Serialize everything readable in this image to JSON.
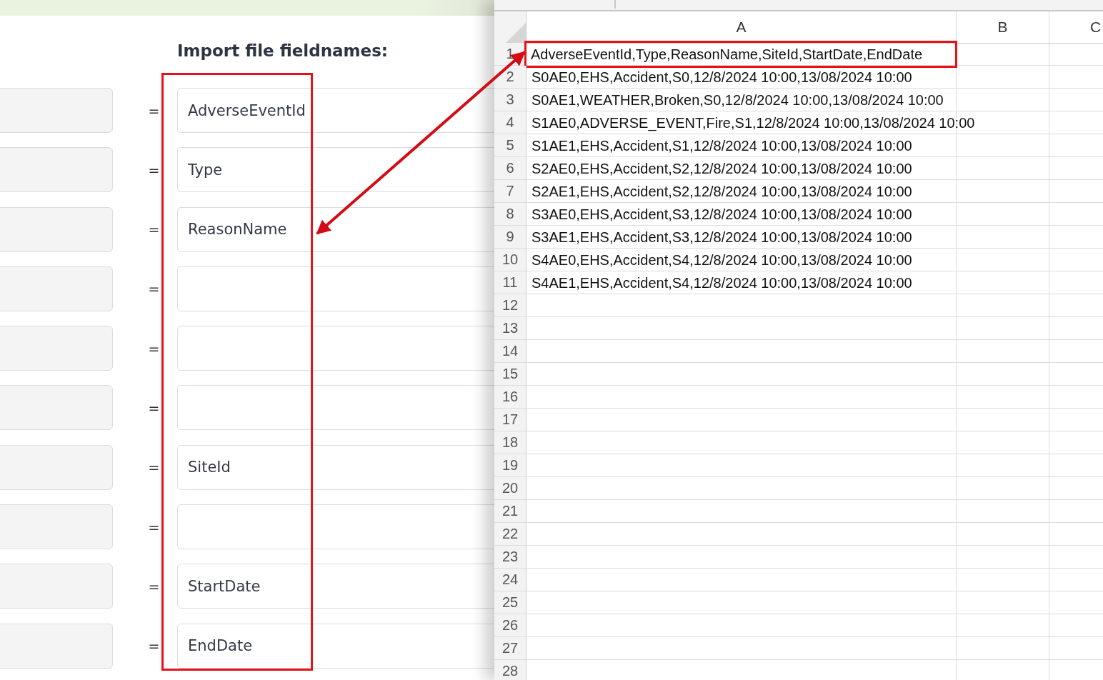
{
  "import_panel": {
    "heading": "Import file fieldnames:",
    "mappings": [
      {
        "separator": "=",
        "value": "AdverseEventId"
      },
      {
        "separator": "=",
        "value": "Type"
      },
      {
        "separator": "=",
        "value": "ReasonName"
      },
      {
        "separator": "="
      },
      {
        "separator": "="
      },
      {
        "separator": "="
      },
      {
        "separator": "=",
        "value": "SiteId"
      },
      {
        "separator": "="
      },
      {
        "separator": "=",
        "value": "StartDate"
      },
      {
        "separator": "=",
        "value": "EndDate"
      }
    ]
  },
  "spreadsheet": {
    "columns": [
      "A",
      "B",
      "C"
    ],
    "rows": [
      {
        "number": "1",
        "cell_a": "AdverseEventId,Type,ReasonName,SiteId,StartDate,EndDate",
        "highlighted": true
      },
      {
        "number": "2",
        "cell_a": "S0AE0,EHS,Accident,S0,12/8/2024 10:00,13/08/2024 10:00",
        "highlighted": false
      },
      {
        "number": "3",
        "cell_a": "S0AE1,WEATHER,Broken,S0,12/8/2024 10:00,13/08/2024 10:00",
        "highlighted": false
      },
      {
        "number": "4",
        "cell_a": "S1AE0,ADVERSE_EVENT,Fire,S1,12/8/2024 10:00,13/08/2024 10:00",
        "highlighted": false
      },
      {
        "number": "5",
        "cell_a": "S1AE1,EHS,Accident,S1,12/8/2024 10:00,13/08/2024 10:00",
        "highlighted": false
      },
      {
        "number": "6",
        "cell_a": "S2AE0,EHS,Accident,S2,12/8/2024 10:00,13/08/2024 10:00",
        "highlighted": false
      },
      {
        "number": "7",
        "cell_a": "S2AE1,EHS,Accident,S2,12/8/2024 10:00,13/08/2024 10:00",
        "highlighted": false
      },
      {
        "number": "8",
        "cell_a": "S3AE0,EHS,Accident,S3,12/8/2024 10:00,13/08/2024 10:00",
        "highlighted": false
      },
      {
        "number": "9",
        "cell_a": "S3AE1,EHS,Accident,S3,12/8/2024 10:00,13/08/2024 10:00",
        "highlighted": false
      },
      {
        "number": "10",
        "cell_a": "S4AE0,EHS,Accident,S4,12/8/2024 10:00,13/08/2024 10:00",
        "highlighted": false
      },
      {
        "number": "11",
        "cell_a": "S4AE1,EHS,Accident,S4,12/8/2024 10:00,13/08/2024 10:00",
        "highlighted": false
      },
      {
        "number": "12"
      },
      {
        "number": "13"
      },
      {
        "number": "14"
      },
      {
        "number": "15"
      },
      {
        "number": "16"
      },
      {
        "number": "17"
      },
      {
        "number": "18"
      },
      {
        "number": "19"
      },
      {
        "number": "20"
      },
      {
        "number": "21"
      },
      {
        "number": "22"
      },
      {
        "number": "23"
      },
      {
        "number": "24"
      },
      {
        "number": "25"
      },
      {
        "number": "26"
      },
      {
        "number": "27"
      },
      {
        "number": "28"
      }
    ]
  }
}
